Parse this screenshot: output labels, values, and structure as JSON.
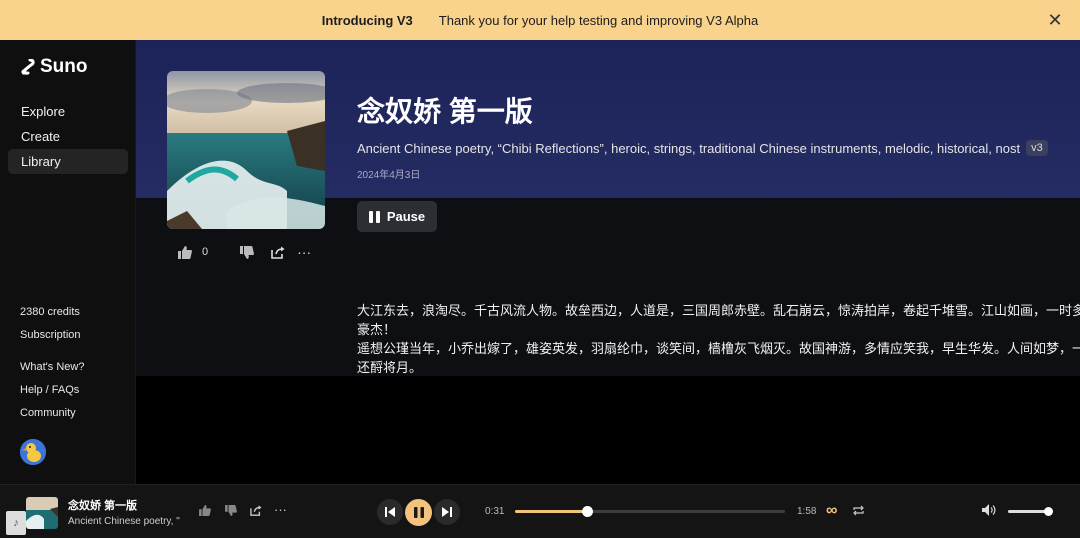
{
  "banner": {
    "title": "Introducing V3",
    "message": "Thank you for your help testing and improving V3 Alpha",
    "close_icon": "close-icon"
  },
  "sidebar": {
    "logo_text": "Suno",
    "nav": [
      {
        "label": "Explore",
        "active": false
      },
      {
        "label": "Create",
        "active": false
      },
      {
        "label": "Library",
        "active": true
      }
    ],
    "credits": "2380 credits",
    "subscription": "Subscription",
    "links": [
      "What's New?",
      "Help / FAQs",
      "Community"
    ]
  },
  "song": {
    "title": "念奴娇 第一版",
    "tags": "Ancient Chinese poetry, “Chibi Reflections”, heroic, strings, traditional Chinese instruments, melodic, historical, nost",
    "version_badge": "v3",
    "date": "2024年4月3日",
    "pause_label": "Pause",
    "like_count": "0"
  },
  "lyrics": [
    "大江东去，浪淘尽。千古风流人物。故垒西边，人道是，三国周郎赤壁。乱石崩云，惊涛拍岸，卷起千堆雪。江山如画，一时多少",
    "豪杰！",
    "遥想公瑾当年，小乔出嫁了，雄姿英发，羽扇纶巾，谈笑间，樯橹灰飞烟灭。故国神游，多情应笑我，早生华发。人间如梦，一尊",
    "还酹将月。"
  ],
  "player": {
    "title": "念奴娇 第一版",
    "subtitle": "Ancient Chinese poetry, \"",
    "current_time": "0:31",
    "duration": "1:58",
    "progress_fraction": 0.265,
    "volume_fraction": 0.95,
    "accent": "#f3c37d"
  }
}
